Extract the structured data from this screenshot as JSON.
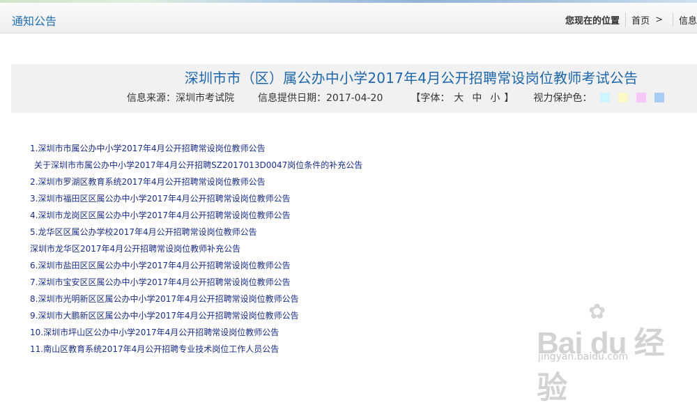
{
  "header": {
    "section_title": "通知公告",
    "breadcrumb": {
      "lead": "您现在的位置",
      "home": "首页",
      "arrow": ">",
      "current": "信息"
    }
  },
  "article": {
    "title": "深圳市市（区）属公办中小学2017年4月公开招聘常设岗位教师考试公告",
    "source": "信息来源：深圳市考试院",
    "date": "信息提供日期：2017-04-20",
    "font_label_open": "【字体：",
    "font_large": "大",
    "font_medium": "中",
    "font_small": "小",
    "font_label_close": "】",
    "eye_care_label": "视力保护色：",
    "eye_care_colors": [
      "#ccf5ff",
      "#fbf9c8",
      "#f7c8f7",
      "#a9cdf3"
    ]
  },
  "links": [
    {
      "text": "1.深圳市市属公办中小学2017年4月公开招聘常设岗位教师公告",
      "indent": false
    },
    {
      "text": "关于深圳市市属公办中小学2017年4月公开招聘SZ2017013D0047岗位条件的补充公告",
      "indent": true
    },
    {
      "text": "2.深圳市罗湖区教育系统2017年4月公开招聘常设岗位教师公告",
      "indent": false
    },
    {
      "text": "3.深圳市福田区区属公办中小学2017年4月公开招聘常设岗位教师公告",
      "indent": false
    },
    {
      "text": "4.深圳市龙岗区区属公办中小学2017年4月公开招聘常设岗位教师公告",
      "indent": false
    },
    {
      "text": "5.龙华区区属公办学校2017年4月公开招聘常设岗位教师公告",
      "indent": false
    },
    {
      "text": "深圳市龙华区2017年4月公开招聘常设岗位教师补充公告",
      "indent": false
    },
    {
      "text": "6.深圳市盐田区区属公办中小学2017年4月公开招聘常设岗位教师公告",
      "indent": false
    },
    {
      "text": "7.深圳市宝安区区属公办中小学2017年4月公开招聘常设岗位教师公告",
      "indent": false
    },
    {
      "text": "8.深圳市光明新区区属公办中小学2017年4月公开招聘常设岗位教师公告",
      "indent": false
    },
    {
      "text": "9.深圳市大鹏新区区属公办中小学2017年4月公开招聘常设岗位教师公告",
      "indent": false
    },
    {
      "text": "10.深圳市坪山区公办中小学2017年4月公开招聘常设岗位教师公告",
      "indent": false
    },
    {
      "text": "11.南山区教育系统2017年4月公开招聘专业技术岗位工作人员公告",
      "indent": false
    }
  ],
  "watermark": {
    "brand": "Bai du 经验",
    "url": "jingyan.baidu.com"
  }
}
